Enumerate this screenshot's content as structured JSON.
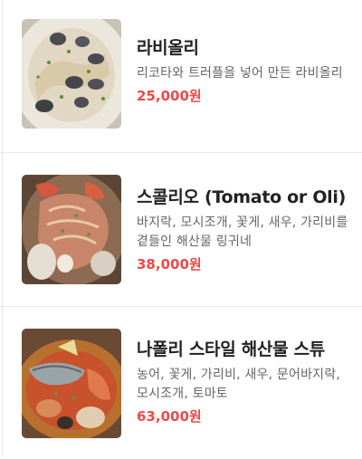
{
  "menu": {
    "items": [
      {
        "name": "라비올리",
        "description_lines": [
          "리코타와 트러플을 넣어 만든 라비올리"
        ],
        "price": "25,000원",
        "image": "ravioli-dish-photo"
      },
      {
        "name": "스콜리오 (Tomato or Oli)",
        "description_lines": [
          "바지락, 모시조개, 꽃게, 새우, 가리비를",
          "곁들인 해산물 링귀네"
        ],
        "price": "38,000원",
        "image": "seafood-linguine-photo"
      },
      {
        "name": "나폴리 스타일 해산물 스튜",
        "description_lines": [
          "농어, 꽃게, 가리비, 새우, 문어바지락,",
          "모시조개, 토마토"
        ],
        "price": "63,000원",
        "image": "seafood-stew-photo"
      }
    ]
  },
  "colors": {
    "price": "#ee4848",
    "name": "#222222",
    "description": "#666666",
    "divider": "#e8e8e8"
  }
}
